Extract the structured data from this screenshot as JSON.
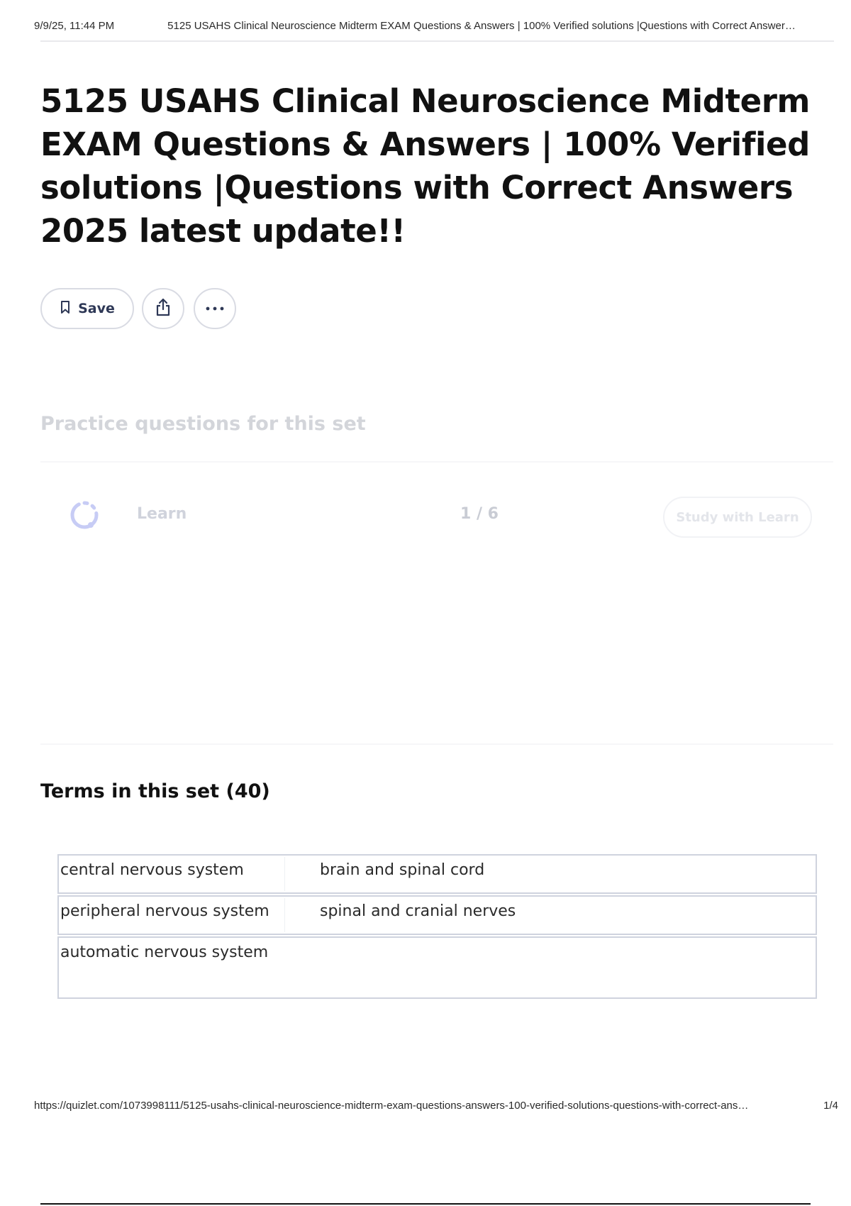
{
  "print_header": {
    "datetime": "9/9/25, 11:44 PM",
    "title": "5125 USAHS Clinical Neuroscience Midterm EXAM Questions & Answers | 100% Verified solutions |Questions with Correct Answer…"
  },
  "page_title": "5125 USAHS Clinical Neuroscience Midterm EXAM Questions & Answers | 100% Verified solutions |Questions with Correct Answers 2025 latest update!!",
  "actions": {
    "save_label": "Save",
    "icons": [
      "bookmark-icon",
      "share-icon",
      "more-icon"
    ]
  },
  "practice": {
    "heading": "Practice questions for this set",
    "mode_label": "Learn",
    "counter": "1 / 6",
    "study_button": "Study with Learn"
  },
  "terms": {
    "heading": "Terms in this set (40)",
    "rows": [
      {
        "term": "central nervous system",
        "definition": "brain and spinal cord"
      },
      {
        "term": "peripheral nervous system",
        "definition": "spinal and cranial nerves"
      },
      {
        "term": "automatic nervous system",
        "definition": ""
      }
    ]
  },
  "print_footer": {
    "url": "https://quizlet.com/1073998111/5125-usahs-clinical-neuroscience-midterm-exam-questions-answers-100-verified-solutions-questions-with-correct-ans…",
    "page": "1/4"
  },
  "colors": {
    "button_border": "#d9dbe3",
    "icon_color": "#2e3856",
    "faded_text": "#d3d5da",
    "learn_icon": "#c7ccf5",
    "table_border": "#cfd3de"
  }
}
